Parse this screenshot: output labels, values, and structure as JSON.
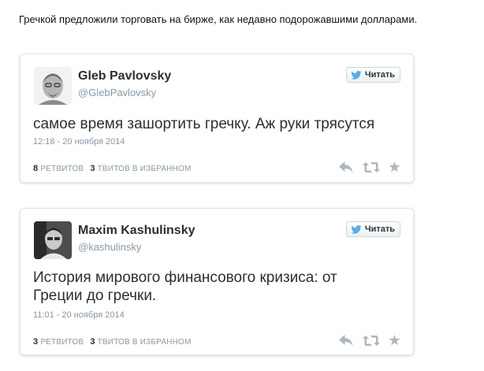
{
  "intro_text": "Гречкой предложили торговать на бирже, как недавно подорожавшими долларами.",
  "colors": {
    "twitter_blue": "#55acee",
    "name_text": "#292f33",
    "meta_text": "#8899a6",
    "action_icon": "#aab8c2",
    "card_border": "#e1e8ed"
  },
  "tweets": [
    {
      "user_name": "Gleb Pavlovsky",
      "screen_name": "@GlebPavlovsky",
      "follow_label": "Читать",
      "text": "самое время зашортить гречку. Аж руки трясутся",
      "timestamp": "12:18 - 20 ноября 2014",
      "retweets": "8",
      "retweets_label": "ретвитов",
      "favorites": "3",
      "favorites_label": "твитов в избранном",
      "icons": [
        "reply-icon",
        "retweet-icon",
        "favorite-icon"
      ]
    },
    {
      "user_name": "Maxim Kashulinsky",
      "screen_name": "@kashulinsky",
      "follow_label": "Читать",
      "text": "История мирового финансового кризиса: от Греции до гречки.",
      "timestamp": "11:01 - 20 ноября 2014",
      "retweets": "3",
      "retweets_label": "ретвитов",
      "favorites": "3",
      "favorites_label": "твитов в избранном",
      "icons": [
        "reply-icon",
        "retweet-icon",
        "favorite-icon"
      ]
    }
  ]
}
